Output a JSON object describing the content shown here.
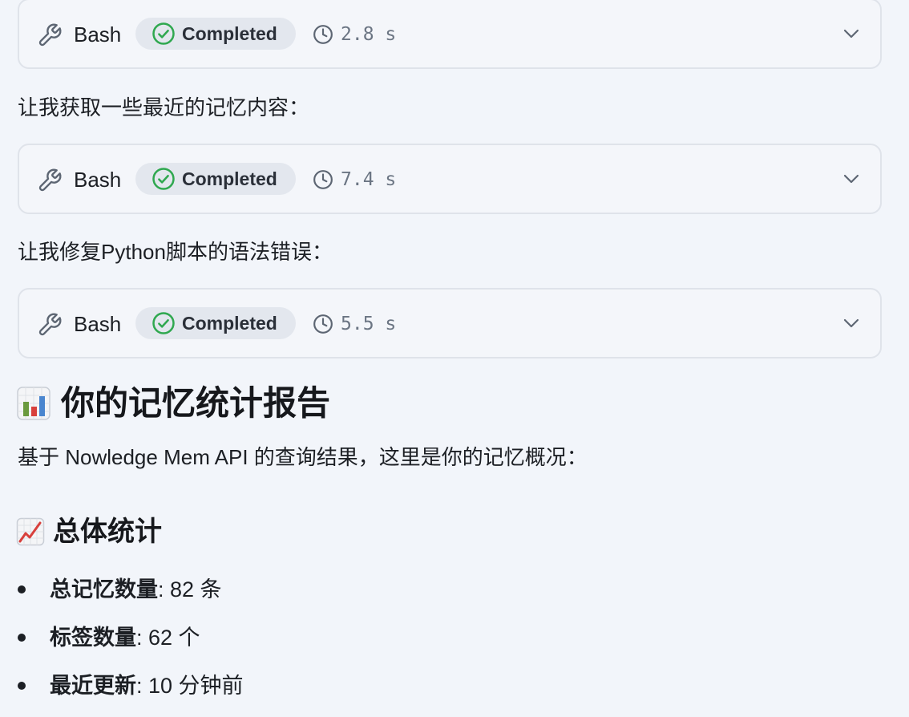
{
  "tool_cards": [
    {
      "tool": "Bash",
      "status": "Completed",
      "duration": "2.8 s",
      "icon": "wrench-icon"
    },
    {
      "tool": "Bash",
      "status": "Completed",
      "duration": "7.4 s",
      "icon": "wrench-icon"
    },
    {
      "tool": "Bash",
      "status": "Completed",
      "duration": "5.5 s",
      "icon": "wrench-icon"
    }
  ],
  "messages": {
    "fetch_memories": "让我获取一些最近的记忆内容：",
    "fix_script": "让我修复Python脚本的语法错误："
  },
  "report": {
    "title": "你的记忆统计报告",
    "title_icon": "bar-chart-emoji",
    "intro": "基于 Nowledge Mem API 的查询结果，这里是你的记忆概况：",
    "section_title": "总体统计",
    "section_icon": "trending-up-emoji",
    "stats": [
      {
        "label": "总记忆数量",
        "value": ": 82 条"
      },
      {
        "label": "标签数量",
        "value": ": 62 个"
      },
      {
        "label": "最近更新",
        "value": ": 10 分钟前"
      }
    ]
  },
  "colors": {
    "background": "#f2f5fa",
    "card_border": "#dfe3ea",
    "badge_bg": "#e3e7ee",
    "success_green": "#2fa84f",
    "muted": "#6b7583"
  }
}
